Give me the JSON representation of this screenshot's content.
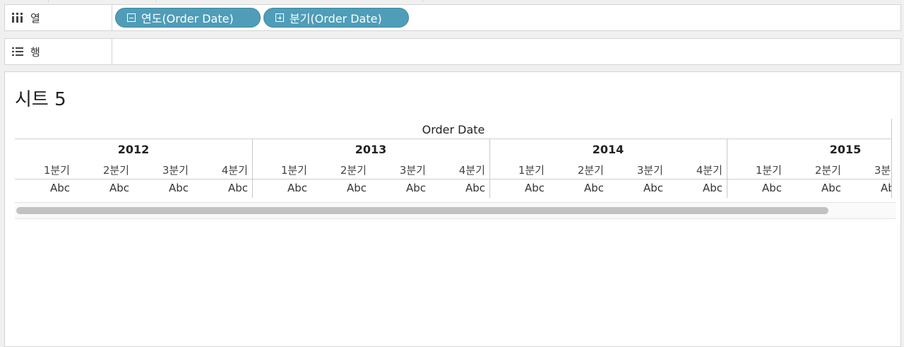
{
  "columns_shelf": {
    "label": "열",
    "icon": "columns-icon",
    "pills": [
      {
        "label": "연도(Order Date)",
        "icon": "collapse-icon"
      },
      {
        "label": "분기(Order Date)",
        "icon": "expand-icon"
      }
    ]
  },
  "rows_shelf": {
    "label": "행",
    "icon": "rows-icon"
  },
  "sheet": {
    "title": "시트 5",
    "field_header": "Order Date",
    "years": [
      "2012",
      "2013",
      "2014",
      "2015"
    ],
    "quarters": [
      "1분기",
      "2분기",
      "3분기",
      "4분기"
    ],
    "mark_text": "Abc"
  },
  "colors": {
    "pill": "#4f9db8",
    "border": "#d4d4d4"
  }
}
